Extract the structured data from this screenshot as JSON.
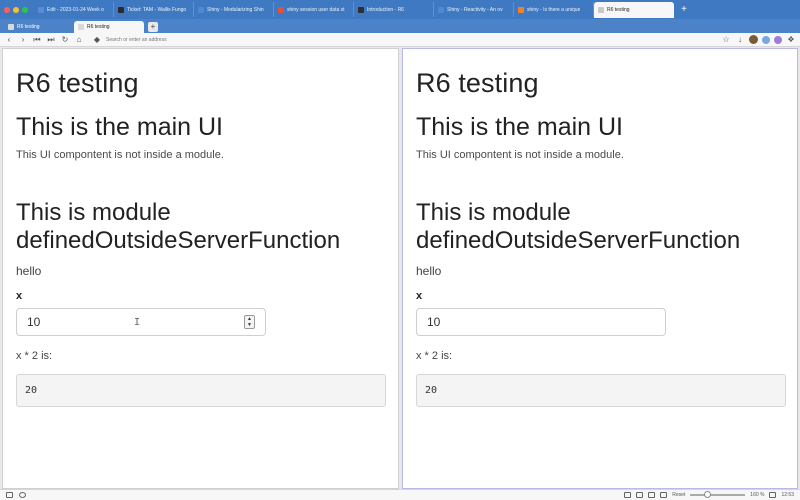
{
  "browser": {
    "top_tabs": [
      {
        "label": "Edit - 2023-01-24 Week o",
        "color": "#5b8bd6"
      },
      {
        "label": "Ticket: TAM - Wallis Fungo",
        "color": "#2b2b2b"
      },
      {
        "label": "Shiny - Modularizing Shin",
        "color": "#4c8ad8"
      },
      {
        "label": "shiny session user data st",
        "color": "#e2513b"
      },
      {
        "label": "Introduction - R6",
        "color": "#2f2f2f"
      },
      {
        "label": "Shiny - Reactivity - An ov",
        "color": "#4c8ad8"
      },
      {
        "label": "shiny - Is there a unique",
        "color": "#f48024"
      },
      {
        "label": "R6 testing",
        "color": "#c9c9c9",
        "active": true
      }
    ],
    "second_row_tabs": [
      {
        "label": "R6 testing",
        "active": false
      },
      {
        "label": "R6 testing",
        "active": true
      }
    ],
    "address_placeholder": "Search or enter an address",
    "status": {
      "reset_label": "Reset",
      "zoom": "160 %",
      "time": "12:53"
    }
  },
  "panes": [
    {
      "title": "R6 testing",
      "main_heading": "This is the main UI",
      "main_note": "This UI compontent is not inside a module.",
      "module_heading": "This is module definedOutsideServerFunction",
      "hello": "hello",
      "x_label": "x",
      "x_value": "10",
      "result_label": "x * 2 is:",
      "result_value": "20"
    },
    {
      "title": "R6 testing",
      "main_heading": "This is the main UI",
      "main_note": "This UI compontent is not inside a module.",
      "module_heading": "This is module definedOutsideServerFunction",
      "hello": "hello",
      "x_label": "x",
      "x_value": "10",
      "result_label": "x * 2 is:",
      "result_value": "20"
    }
  ]
}
